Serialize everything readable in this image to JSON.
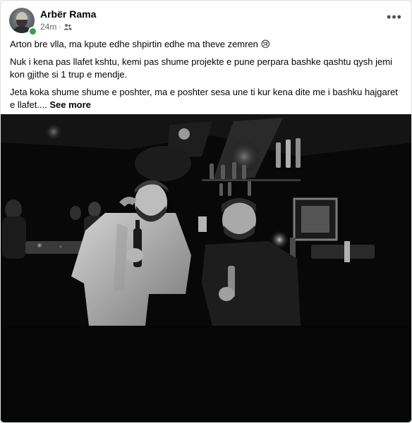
{
  "post": {
    "author": "Arbër Rama",
    "timestamp": "24m",
    "separator": "·",
    "audience_icon": "friends-icon",
    "more_label": "•••",
    "paragraphs": [
      "Arton bre vlla, ma kpute edhe shpirtin edhe ma theve zemren 😢",
      "Nuk i kena pas llafet kshtu, kemi pas shume projekte e pune perpara bashke qashtu qysh jemi kon gjithe si 1 trup e mendje.",
      "Jeta koka shume shume e poshter, ma e poshter sesa une ti kur kena dite me i bashku hajgaret e llafet...."
    ],
    "see_more": "See more"
  },
  "colors": {
    "online": "#31a24c",
    "meta_text": "#65676b",
    "photo_bg": "#070707"
  }
}
